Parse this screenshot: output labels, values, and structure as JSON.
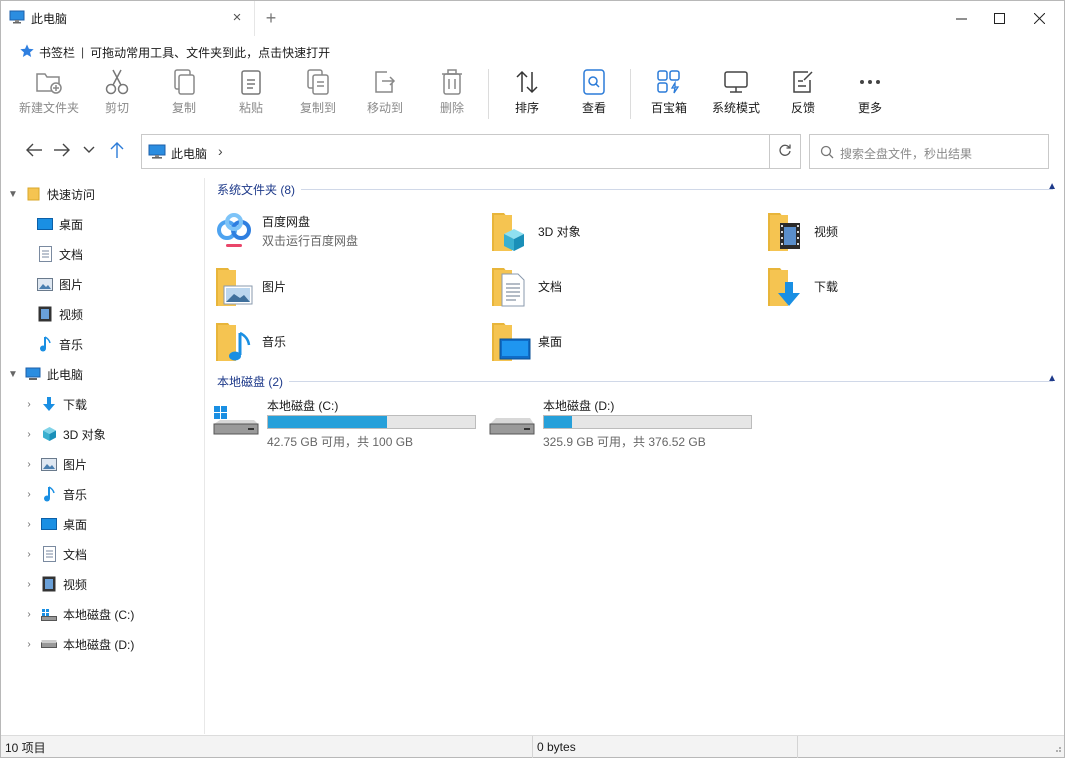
{
  "tab": {
    "title": "此电脑",
    "close": "×",
    "new": "+"
  },
  "window_controls": {
    "minimize": "minimize",
    "maximize": "maximize",
    "close": "close"
  },
  "bookmark_bar": {
    "label": "书签栏",
    "separator": "|",
    "hint": "可拖动常用工具、文件夹到此，点击快速打开"
  },
  "toolbar": {
    "new_folder": "新建文件夹",
    "cut": "剪切",
    "copy": "复制",
    "paste": "粘贴",
    "copy_to": "复制到",
    "move_to": "移动到",
    "delete": "删除",
    "sort": "排序",
    "view": "查看",
    "toolbox": "百宝箱",
    "system_mode": "系统模式",
    "feedback": "反馈",
    "more": "更多"
  },
  "address": {
    "path": "此电脑",
    "chevron": "›"
  },
  "search": {
    "placeholder": "搜索全盘文件，秒出结果"
  },
  "sidebar": {
    "quick_access": "快速访问",
    "quick_items": [
      "桌面",
      "文档",
      "图片",
      "视频",
      "音乐"
    ],
    "this_pc": "此电脑",
    "pc_items": [
      "下载",
      "3D 对象",
      "图片",
      "音乐",
      "桌面",
      "文档",
      "视频",
      "本地磁盘 (C:)",
      "本地磁盘 (D:)"
    ]
  },
  "content": {
    "system_folders_header": "系统文件夹 (8)",
    "folders": [
      {
        "name": "百度网盘",
        "sub": "双击运行百度网盘",
        "icon": "baidu-netdisk-icon"
      },
      {
        "name": "3D 对象",
        "icon": "3d-objects-folder-icon"
      },
      {
        "name": "视频",
        "icon": "videos-folder-icon"
      },
      {
        "name": "图片",
        "icon": "pictures-folder-icon"
      },
      {
        "name": "文档",
        "icon": "documents-folder-icon"
      },
      {
        "name": "下载",
        "icon": "downloads-folder-icon"
      },
      {
        "name": "音乐",
        "icon": "music-folder-icon"
      },
      {
        "name": "桌面",
        "icon": "desktop-folder-icon"
      }
    ],
    "drives_header": "本地磁盘 (2)",
    "drives": [
      {
        "name": "本地磁盘 (C:)",
        "free": "42.75 GB 可用，共 100 GB",
        "used_fraction": 0.5725
      },
      {
        "name": "本地磁盘 (D:)",
        "free": "325.9 GB 可用，共 376.52 GB",
        "used_fraction": 0.1345
      }
    ]
  },
  "status": {
    "items": "10 项目",
    "size": "0 bytes"
  },
  "colors": {
    "accent": "#26a0da",
    "folder": "#f5c451",
    "header_text": "#1e3a8a",
    "star": "#2f7fe0"
  }
}
